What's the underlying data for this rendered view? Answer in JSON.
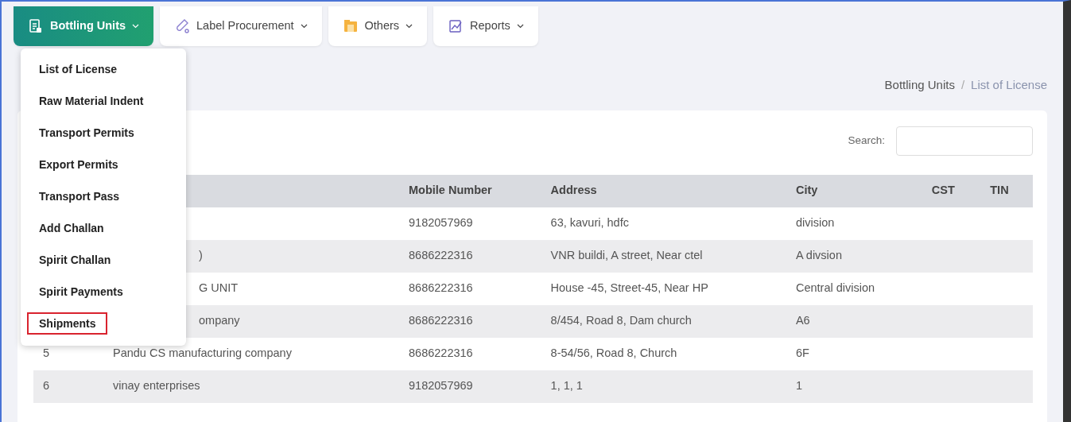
{
  "menu_tabs": [
    {
      "label": "Bottling Units",
      "selected": true
    },
    {
      "label": "Label Procurement",
      "selected": false
    },
    {
      "label": "Others",
      "selected": false
    },
    {
      "label": "Reports",
      "selected": false
    }
  ],
  "dropdown": {
    "items": [
      {
        "label": "List of License",
        "highlighted": false
      },
      {
        "label": "Raw Material Indent",
        "highlighted": false
      },
      {
        "label": "Transport Permits",
        "highlighted": false
      },
      {
        "label": "Export Permits",
        "highlighted": false
      },
      {
        "label": "Transport Pass",
        "highlighted": false
      },
      {
        "label": "Add Challan",
        "highlighted": false
      },
      {
        "label": "Spirit Challan",
        "highlighted": false
      },
      {
        "label": "Spirit Payments",
        "highlighted": false
      },
      {
        "label": "Shipments",
        "highlighted": true
      }
    ]
  },
  "breadcrumb_separator": "/",
  "breadcrumb": [
    {
      "label": "Bottling Units",
      "current": false
    },
    {
      "label": "List of License",
      "current": true
    }
  ],
  "search": {
    "label": "Search:"
  },
  "table": {
    "columns": [
      "Mobile Number",
      "Address",
      "City",
      "CST",
      "TIN"
    ],
    "rows": [
      {
        "index": "",
        "name": "",
        "cells": [
          "9182057969",
          "63, kavuri, hdfc",
          "division",
          "",
          ""
        ]
      },
      {
        "index": "",
        "name": ")",
        "cells": [
          "8686222316",
          "VNR buildi, A street, Near ctel",
          "A divsion",
          "",
          ""
        ]
      },
      {
        "index": "",
        "name": "G UNIT",
        "cells": [
          "8686222316",
          "House -45, Street-45, Near HP",
          "Central division",
          "",
          ""
        ]
      },
      {
        "index": "",
        "name": "ompany",
        "cells": [
          "8686222316",
          "8/454, Road 8, Dam church",
          "A6",
          "",
          ""
        ]
      },
      {
        "index": "5",
        "name": "Pandu CS manufacturing company",
        "cells": [
          "8686222316",
          "8-54/56, Road 8, Church",
          "6F",
          "",
          ""
        ]
      },
      {
        "index": "6",
        "name": "vinay enterprises",
        "cells": [
          "9182057969",
          "1, 1, 1",
          "1",
          "",
          ""
        ]
      }
    ]
  }
}
